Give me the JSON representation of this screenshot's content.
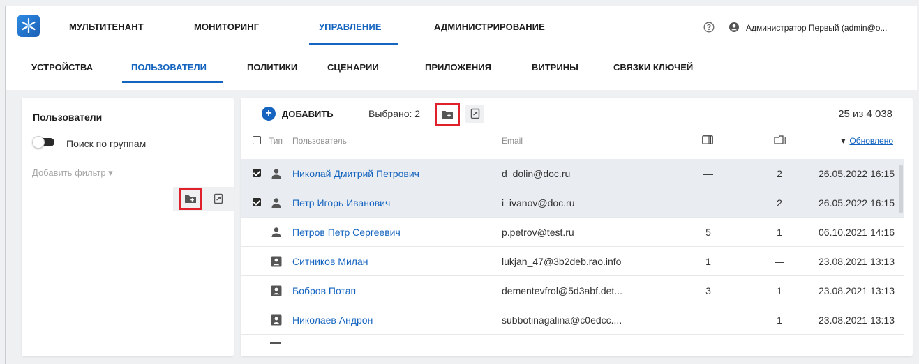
{
  "topnav": {
    "items": [
      "МУЛЬТИТЕНАНТ",
      "МОНИТОРИНГ",
      "УПРАВЛЕНИЕ",
      "АДМИНИСТРИРОВАНИЕ"
    ],
    "active": "УПРАВЛЕНИЕ",
    "user_name": "Администратор Первый (admin@o...",
    "icons": [
      "logo-icon",
      "help-icon",
      "user-account-icon"
    ]
  },
  "subnav": {
    "items": [
      "УСТРОЙСТВА",
      "ПОЛЬЗОВАТЕЛИ",
      "ПОЛИТИКИ",
      "СЦЕНАРИИ",
      "ПРИЛОЖЕНИЯ",
      "ВИТРИНЫ",
      "СВЯЗКИ КЛЮЧЕЙ"
    ],
    "active": "ПОЛЬЗОВАТЕЛИ"
  },
  "left_panel": {
    "title": "Пользователи",
    "toggle_label": "Поиск по группам",
    "toggle_on": false,
    "add_filter": "Добавить фильтр ▾"
  },
  "main": {
    "add_label": "ДОБАВИТЬ",
    "selected_label": "Выбрано: 2",
    "count_label": "25 из 4 038",
    "columns": {
      "type": "Тип",
      "user": "Пользователь",
      "email": "Email",
      "updated": "Обновлено"
    },
    "sort_indicator": "▾",
    "rows": [
      {
        "selected": true,
        "type": "user",
        "name": "Николай Дмитрий Петрович",
        "email": "d_dolin@doc.ru",
        "a": "—",
        "b": "2",
        "date": "26.05.2022 16:15"
      },
      {
        "selected": true,
        "type": "user",
        "name": "Петр Игорь Иванович",
        "email": "i_ivanov@doc.ru",
        "a": "—",
        "b": "2",
        "date": "26.05.2022 16:15"
      },
      {
        "selected": false,
        "type": "user",
        "name": "Петров Петр Сергеевич",
        "email": "p.petrov@test.ru",
        "a": "5",
        "b": "1",
        "date": "06.10.2021 14:16"
      },
      {
        "selected": false,
        "type": "contact",
        "name": "Ситников Милан",
        "email": "lukjan_47@3b2deb.rao.info",
        "a": "1",
        "b": "—",
        "date": "23.08.2021 13:13"
      },
      {
        "selected": false,
        "type": "contact",
        "name": "Бобров Потап",
        "email": "dementevfrol@5d3abf.det...",
        "a": "3",
        "b": "1",
        "date": "23.08.2021 13:13"
      },
      {
        "selected": false,
        "type": "contact",
        "name": "Николаев Андрон",
        "email": "subbotinagalina@c0edcc....",
        "a": "—",
        "b": "1",
        "date": "23.08.2021 13:13"
      }
    ]
  },
  "colors": {
    "accent": "#1565c0",
    "highlight": "#e0202a",
    "selected_row": "#e9ecf0"
  }
}
